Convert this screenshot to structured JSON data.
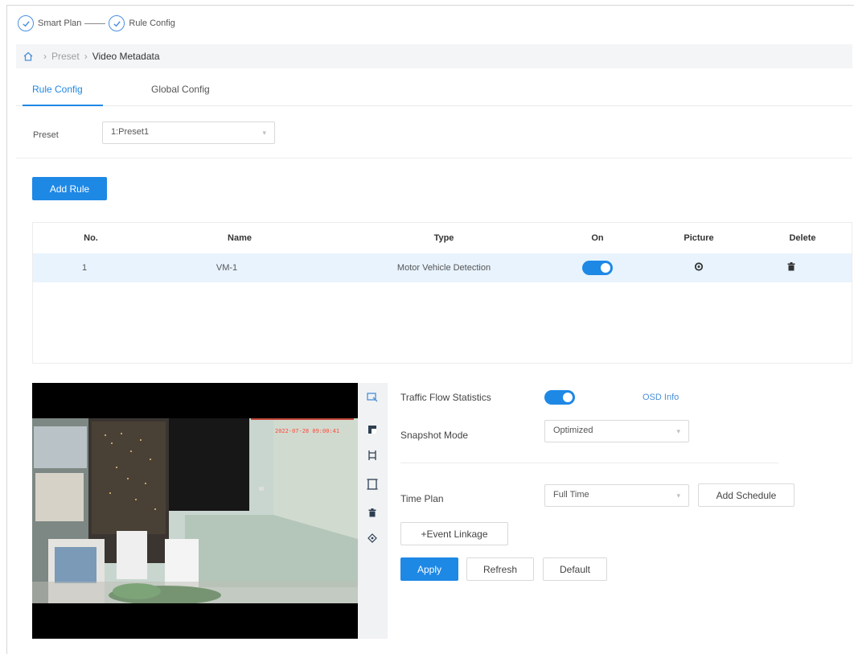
{
  "stepper": {
    "steps": [
      "Smart Plan",
      "Rule Config"
    ]
  },
  "breadcrumb": {
    "items": [
      "Preset",
      "Video Metadata"
    ]
  },
  "tabs": [
    {
      "label": "Rule Config"
    },
    {
      "label": "Global Config"
    }
  ],
  "preset": {
    "label": "Preset",
    "value": "1:Preset1"
  },
  "add_rule_label": "Add Rule",
  "table": {
    "headers": [
      "No.",
      "Name",
      "Type",
      "On",
      "Picture",
      "Delete"
    ],
    "rows": [
      {
        "no": "1",
        "name": "VM-1",
        "type": "Motor Vehicle Detection",
        "on": true
      }
    ]
  },
  "video": {
    "timestamp": "2022-07-28 09:00:41"
  },
  "form": {
    "traffic_flow_label": "Traffic Flow Statistics",
    "traffic_flow_on": true,
    "osd_info_link": "OSD Info",
    "snapshot_label": "Snapshot Mode",
    "snapshot_value": "Optimized",
    "time_plan_label": "Time Plan",
    "time_plan_value": "Full Time",
    "add_schedule": "Add Schedule",
    "event_linkage": "+Event Linkage",
    "apply": "Apply",
    "refresh": "Refresh",
    "default": "Default"
  },
  "colors": {
    "accent": "#1e88e5",
    "row_highlight": "#e8f3fd",
    "link": "#4a8fd8"
  }
}
